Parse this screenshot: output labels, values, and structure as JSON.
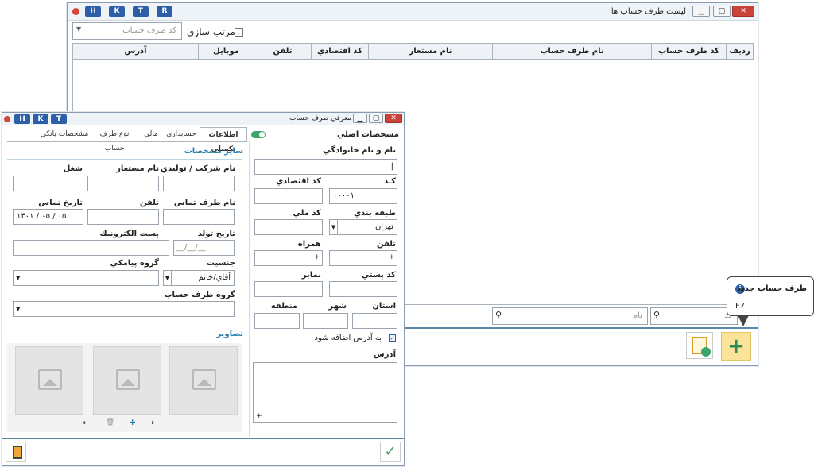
{
  "back_window": {
    "title": "ليست طرف حساب ها",
    "hk": [
      "H",
      "K",
      "T",
      "R"
    ],
    "sort_label": "مرتب سازي",
    "sort_field_placeholder": "كد طرف حساب",
    "columns": [
      "رديف",
      "كد طرف حساب",
      "نام طرف حساب",
      "نام مستعار",
      "كد اقتصادي",
      "تلفن",
      "موبايل",
      "آدرس"
    ],
    "filter_code_placeholder": "كد",
    "filter_name_placeholder": "نام"
  },
  "tooltip": {
    "title": "طرف حساب جديد",
    "shortcut": "F7"
  },
  "front_window": {
    "title": "معرفي طرف حساب",
    "hk": [
      "H",
      "K",
      "T"
    ],
    "main_header": "مشخصات اصلي",
    "tabs": [
      "اطلاعات تكميلي",
      "حسابداري",
      "مالي",
      "نوع طرف حساب",
      "مشخصات بانكي"
    ],
    "left": {
      "name_label": "نام و نام خانوادگي",
      "name_value": "|",
      "code_label": "كـد",
      "code_value": "۰۰۰۰۱",
      "economic_code_label": "كد اقتصادي",
      "category_label": "طبقه بندي",
      "category_value": "تهران",
      "national_code_label": "كد ملي",
      "phone_label": "تلفن",
      "mobile_label": "همراه",
      "postal_code_label": "كد پستي",
      "fax_label": "نمابر",
      "province_label": "استان",
      "city_label": "شهر",
      "region_label": "منطقه",
      "add_to_address_label": "به آدرس اضافه شود",
      "address_label": "آدرس"
    },
    "right": {
      "section_title": "ساير مشخصات",
      "company_label": "نام شركت / توليدي",
      "alias_label": "نام مستعار",
      "job_label": "شغل",
      "contact_name_label": "نام طرف تماس",
      "phone_label": "تلفن",
      "contact_date_label": "تاريخ تماس",
      "contact_date_value": "۱۴۰۱ / ۰۵ / ۰۵",
      "birth_date_label": "تاريخ تولد",
      "birth_date_value": "__/__/__",
      "email_label": "پست الكترونيك",
      "gender_label": "جنسيت",
      "gender_value": "آقاي/خانم",
      "sms_group_label": "گروه پيامكي",
      "account_group_label": "گروه طرف حساب",
      "images_title": "تصاوير"
    }
  }
}
